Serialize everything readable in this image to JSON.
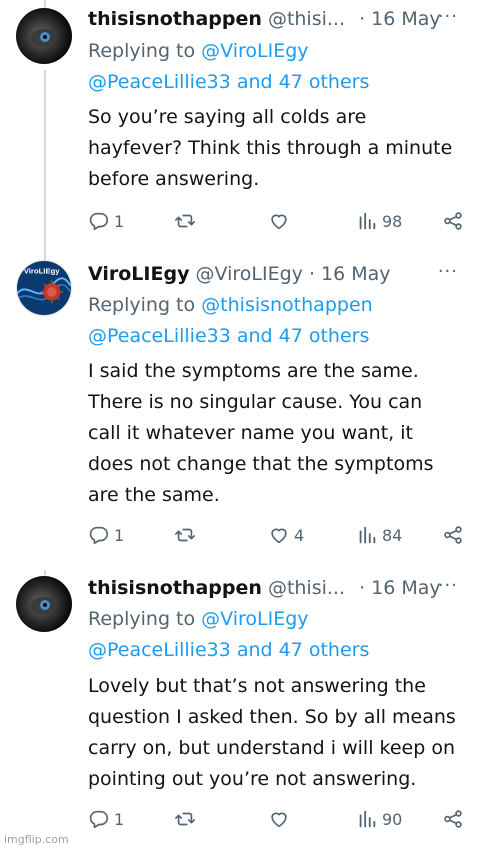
{
  "tweets": [
    {
      "name": "thisisnothappen",
      "handle": "@thisi...",
      "date": "· 16 May",
      "more": "···",
      "reply_prefix": "Replying to",
      "reply_to": "@ViroLIEgy",
      "reply_others": "@PeaceLillie33 and 47 others",
      "body_lines": [
        "So you’re saying all colds are",
        "hayfever? Think this through a minute",
        "before answering."
      ],
      "replies": "1",
      "retweets": "",
      "likes": "",
      "views": "98",
      "avatar_icon": "dark-eye-avatar"
    },
    {
      "name": "ViroLIEgy",
      "handle": "@ViroLIEgy",
      "date": "· 16 May",
      "more": "···",
      "reply_prefix": "Replying to",
      "reply_to": "@thisisnothappen",
      "reply_others": "@PeaceLillie33 and 47 others",
      "body_lines": [
        "I said the symptoms are the same.",
        "There is no singular cause. You can",
        "call it whatever name you want, it",
        "does not change that the symptoms",
        "are the same."
      ],
      "replies": "1",
      "retweets": "",
      "likes": "4",
      "views": "84",
      "avatar_icon": "virus-avatar",
      "avatar_text": "ViroLIEgy"
    },
    {
      "name": "thisisnothappen",
      "handle": "@thisi...",
      "date": "· 16 May",
      "more": "···",
      "reply_prefix": "Replying to",
      "reply_to": "@ViroLIEgy",
      "reply_others": "@PeaceLillie33 and 47 others",
      "body_lines": [
        "Lovely but that’s not answering the",
        "question I asked then. So by all means",
        "carry on, but understand i will keep on",
        "pointing out you’re not answering."
      ],
      "replies": "1",
      "retweets": "",
      "likes": "",
      "views": "90",
      "avatar_icon": "dark-eye-avatar"
    }
  ],
  "watermark": "imgflip.com",
  "colors": {
    "link": "#1d9bf0",
    "muted": "#536471",
    "text": "#0f1419",
    "thread_line": "#cfd9de"
  }
}
